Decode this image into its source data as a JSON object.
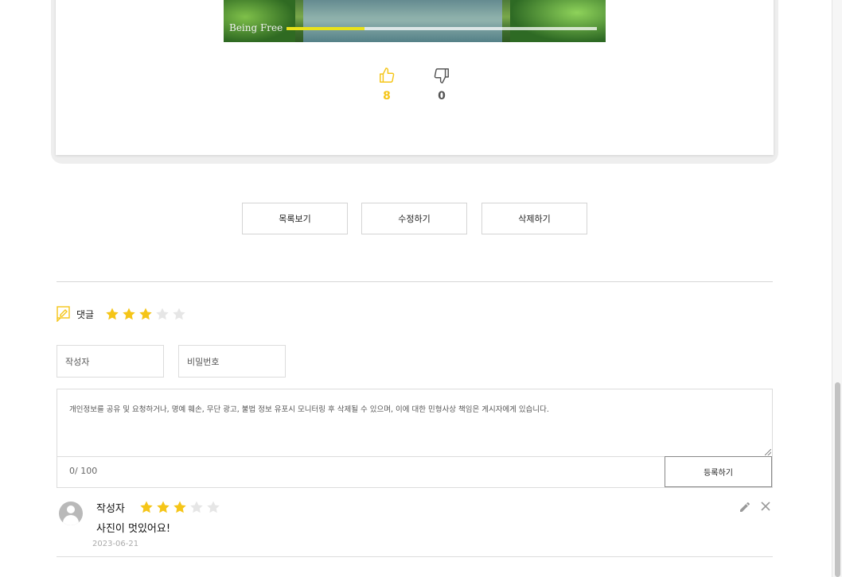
{
  "media": {
    "caption": "Being Free",
    "progress": 0.25,
    "track_color": "#e9e21a"
  },
  "votes": {
    "like_count": "8",
    "dislike_count": "0",
    "like_color": "#f5c518"
  },
  "actions": {
    "list_label": "목록보기",
    "edit_label": "수정하기",
    "delete_label": "삭제하기"
  },
  "comments_section": {
    "title": "댓글",
    "rating": 3,
    "rating_max": 5,
    "author_placeholder": "작성자",
    "password_placeholder": "비밀번호",
    "notice": "개인정보를 공유 및 요청하거나, 명예 훼손, 무단 광고, 불법 정보 유포시 모니터링 후 삭제될 수 있으며, 이에 대한 민형사상 책임은 게시자에게 있습니다.",
    "char_counter": "0/ 100",
    "submit_label": "등록하기",
    "star_color": "#f5c518"
  },
  "comments": [
    {
      "author": "작성자",
      "rating": 3,
      "text": "사진이 멋있어요!",
      "date": "2023-06-21"
    }
  ]
}
